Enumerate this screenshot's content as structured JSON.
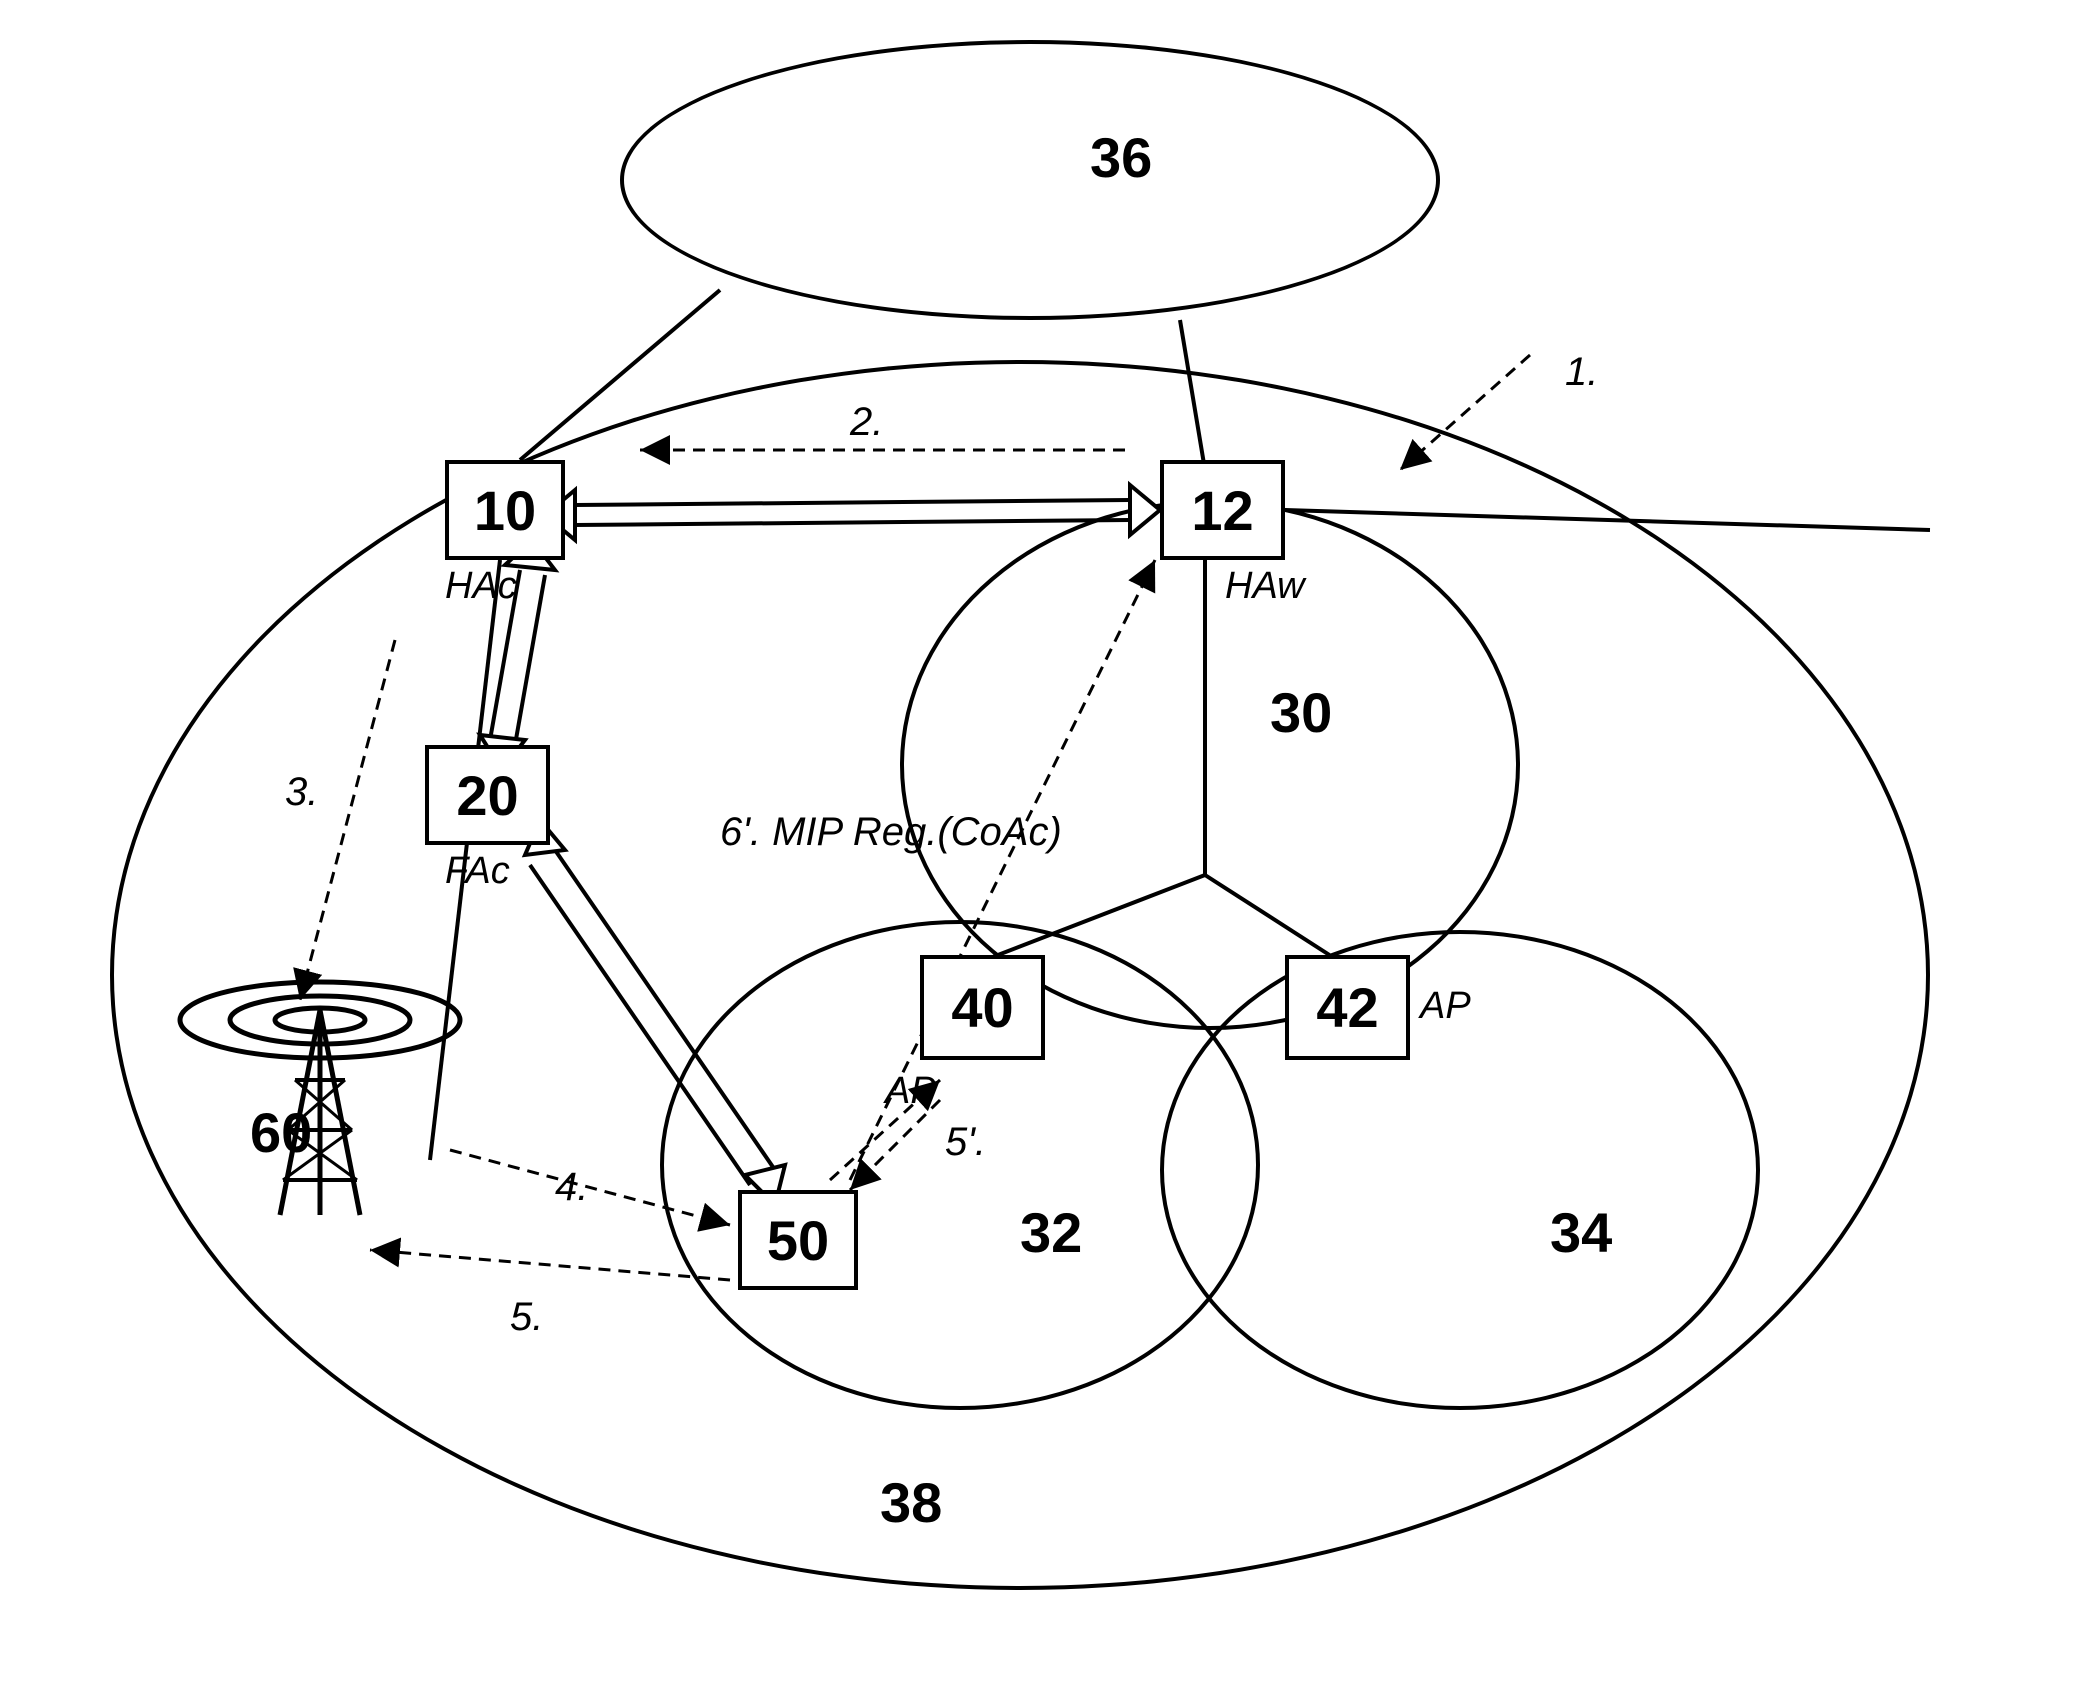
{
  "diagram": {
    "type": "network-topology",
    "description": "Mobile IP network handoff diagram"
  },
  "regions": {
    "external": {
      "id": "36"
    },
    "main": {
      "id": "38"
    },
    "wlan_home": {
      "id": "30"
    },
    "wlan_ap1": {
      "id": "32"
    },
    "wlan_ap2": {
      "id": "34"
    },
    "cell": {
      "id": "60"
    }
  },
  "nodes": {
    "hac": {
      "id": "10",
      "label": "HAc"
    },
    "haw": {
      "id": "12",
      "label": "HAw"
    },
    "fac": {
      "id": "20",
      "label": "FAc"
    },
    "ap1": {
      "id": "40",
      "label": "AP"
    },
    "ap2": {
      "id": "42",
      "label": "AP"
    },
    "mn": {
      "id": "50"
    }
  },
  "steps": {
    "s1": "1.",
    "s2": "2.",
    "s3": "3.",
    "s4": "4.",
    "s5": "5.",
    "s5p": "5'.",
    "s6p": "6'. MIP Reg.(CoAc)"
  }
}
